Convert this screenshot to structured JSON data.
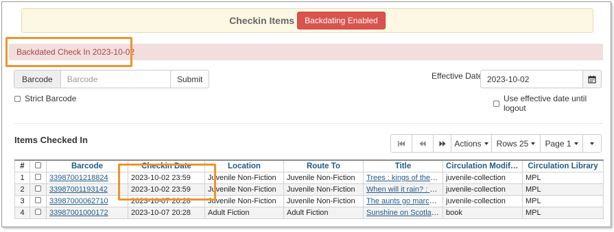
{
  "header": {
    "title": "Checkin Items",
    "badge": "Backdating Enabled"
  },
  "alert": {
    "text": "Backdated Check In 2023-10-02"
  },
  "barcode_form": {
    "addon_label": "Barcode",
    "placeholder": "Barcode",
    "value": "",
    "submit_label": "Submit",
    "strict_label": "Strict Barcode"
  },
  "effective_date": {
    "label": "Effective Date",
    "value": "2023-10-02",
    "until_logout_label": "Use effective date until logout"
  },
  "items_section": {
    "title": "Items Checked In",
    "actions_label": "Actions",
    "rows_label": "Rows 25",
    "page_label": "Page 1"
  },
  "table": {
    "columns": [
      "#",
      "Barcode",
      "Checkin Date",
      "Location",
      "Route To",
      "Title",
      "Circulation Modifier",
      "Circulation Library"
    ],
    "rows": [
      {
        "num": "1",
        "barcode": "33987001218824",
        "checkin_date": "2023-10-02 23:59",
        "location": "Juvenile Non-Fiction",
        "route_to": "Juvenile Non-Fiction",
        "title": "Trees : kings of the forest",
        "modifier": "juvenile-collection",
        "library": "MPL"
      },
      {
        "num": "2",
        "barcode": "33987001193142",
        "checkin_date": "2023-10-02 23:59",
        "location": "Juvenile Non-Fiction",
        "route_to": "Juvenile Non-Fiction",
        "title": "When will it rain? : noticing weather patterns",
        "modifier": "juvenile-collection",
        "library": "MPL"
      },
      {
        "num": "3",
        "barcode": "33987000062710",
        "checkin_date": "2023-10-07 20:28",
        "location": "Juvenile Non-Fiction",
        "route_to": "Juvenile Non-Fiction",
        "title": "The aunts go marching",
        "modifier": "juvenile-collection",
        "library": "MPL"
      },
      {
        "num": "4",
        "barcode": "33987001000172",
        "checkin_date": "2023-10-07 20:28",
        "location": "Adult Fiction",
        "route_to": "Adult Fiction",
        "title": "Sunshine on Scotland Street",
        "modifier": "book",
        "library": "MPL"
      }
    ]
  },
  "colors": {
    "badge_danger": "#d9534f",
    "alert_bg": "#f2dede",
    "alert_text": "#a94442",
    "header_bg": "#fcf8e3",
    "highlight": "#f0922b",
    "link": "#1f5a86"
  }
}
